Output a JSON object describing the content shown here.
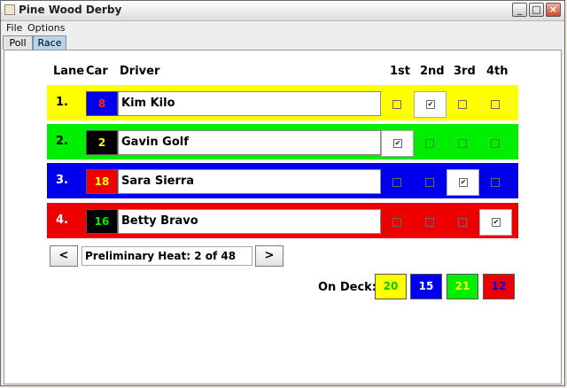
{
  "window": {
    "title": "Pine Wood Derby"
  },
  "menu": [
    "File",
    "Options"
  ],
  "tabs": [
    {
      "label": "Poll",
      "active": false
    },
    {
      "label": "Race",
      "active": true
    }
  ],
  "headers": {
    "lane": "Lane",
    "car": "Car",
    "driver": "Driver",
    "places": [
      "1st",
      "2nd",
      "3rd",
      "4th"
    ]
  },
  "lanes": [
    {
      "lane": "1.",
      "car": "8",
      "driver": "Kim Kilo",
      "row_color": "#ffff00",
      "car_bg": "#0000ee",
      "car_fg": "#ff2020",
      "lane_fg": "#000000",
      "checked": [
        false,
        true,
        false,
        false
      ]
    },
    {
      "lane": "2.",
      "car": "2",
      "driver": "Gavin Golf",
      "row_color": "#00ee00",
      "car_bg": "#000000",
      "car_fg": "#ffff00",
      "lane_fg": "#000000",
      "checked": [
        true,
        false,
        false,
        false
      ]
    },
    {
      "lane": "3.",
      "car": "18",
      "driver": "Sara Sierra",
      "row_color": "#0000ee",
      "car_bg": "#ee0000",
      "car_fg": "#ffff00",
      "lane_fg": "#ffffff",
      "checked": [
        false,
        false,
        true,
        false
      ]
    },
    {
      "lane": "4.",
      "car": "16",
      "driver": "Betty Bravo",
      "row_color": "#ee0000",
      "car_bg": "#000000",
      "car_fg": "#00ee00",
      "lane_fg": "#ffffff",
      "checked": [
        false,
        false,
        false,
        true
      ]
    }
  ],
  "heat": {
    "prev_label": "<",
    "next_label": ">",
    "text": "Preliminary Heat: 2 of 48"
  },
  "on_deck": {
    "label": "On Deck:",
    "cars": [
      {
        "car": "20",
        "bg": "#ffff00",
        "fg": "#00cc00"
      },
      {
        "car": "15",
        "bg": "#0000ee",
        "fg": "#ffffff"
      },
      {
        "car": "21",
        "bg": "#00ee00",
        "fg": "#ffff00"
      },
      {
        "car": "12",
        "bg": "#ee0000",
        "fg": "#0000ee"
      }
    ]
  },
  "icons": {
    "app": "cup-icon",
    "minimize": "minimize-icon",
    "maximize": "maximize-icon",
    "close": "close-icon",
    "checkmark": "checkmark-icon"
  }
}
